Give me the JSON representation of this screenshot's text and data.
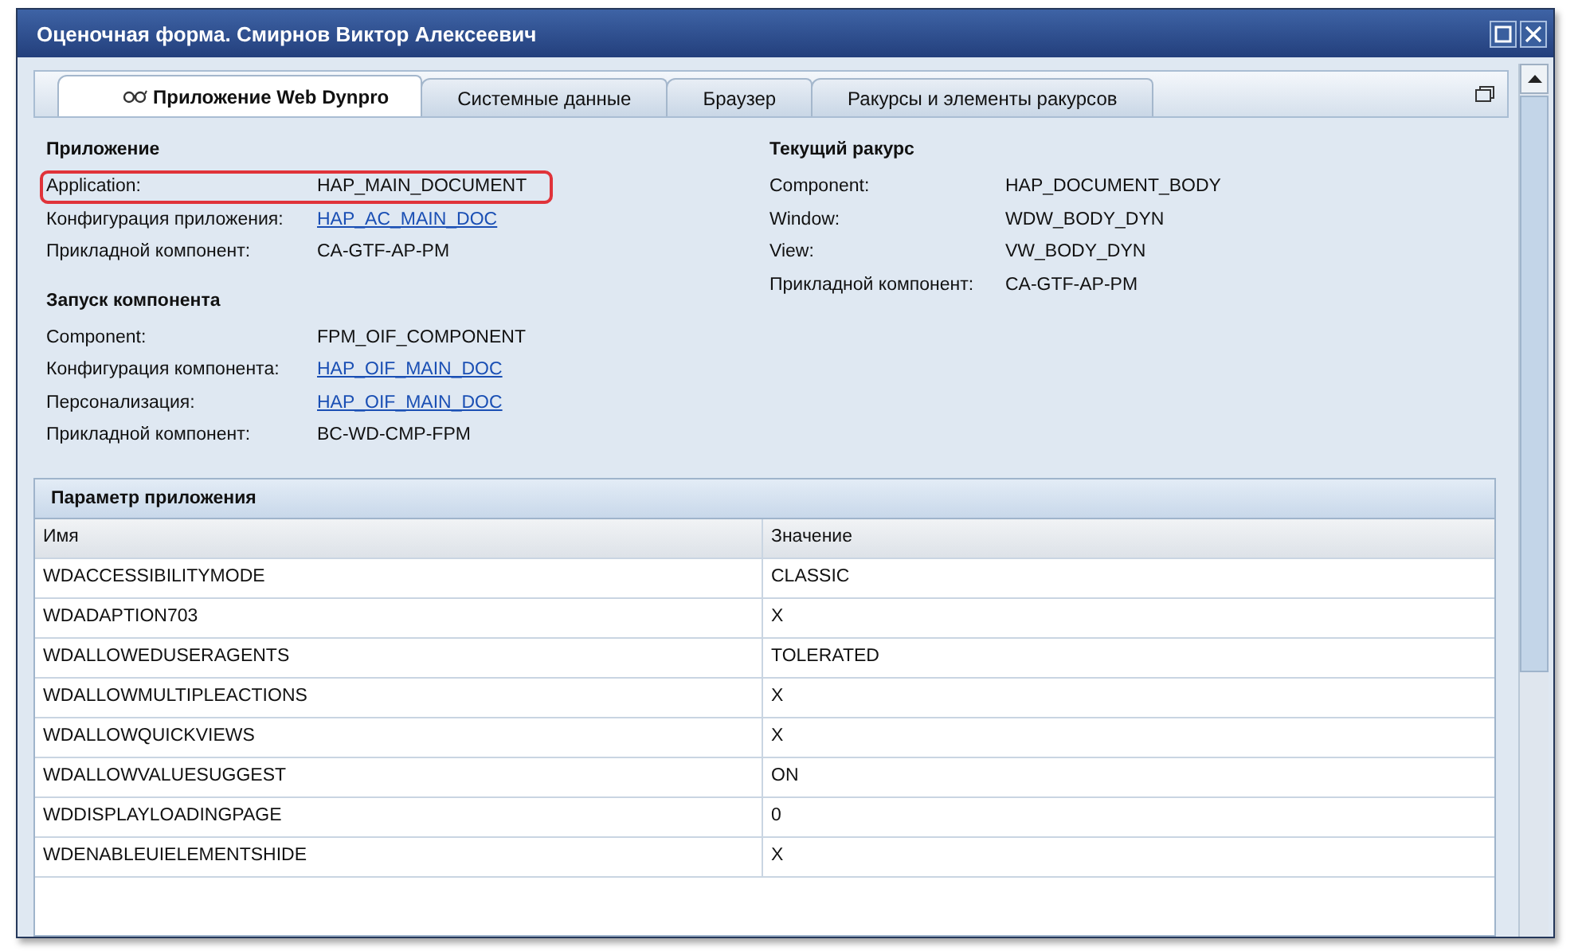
{
  "window": {
    "title": "Оценочная форма. Смирнов Виктор Алексеевич"
  },
  "tabs": [
    {
      "label": "Приложение Web Dynpro",
      "selected": true
    },
    {
      "label": "Системные данные",
      "selected": false
    },
    {
      "label": "Браузер",
      "selected": false
    },
    {
      "label": "Ракурсы и элементы ракурсов",
      "selected": false
    }
  ],
  "sections": [
    {
      "title": "Приложение",
      "fields": [
        {
          "label": "Application:",
          "value": "HAP_MAIN_DOCUMENT",
          "kind": "text",
          "highlighted": true
        },
        {
          "label": "Конфигурация приложения:",
          "value": "HAP_AC_MAIN_DOC",
          "kind": "link",
          "highlighted": false
        },
        {
          "label": "Прикладной компонент:",
          "value": "CA-GTF-AP-PM",
          "kind": "text",
          "highlighted": false
        }
      ]
    },
    {
      "title": "Текущий ракурс",
      "fields": [
        {
          "label": "Component:",
          "value": "HAP_DOCUMENT_BODY",
          "kind": "text",
          "highlighted": false
        },
        {
          "label": "Window:",
          "value": "WDW_BODY_DYN",
          "kind": "text",
          "highlighted": false
        },
        {
          "label": "View:",
          "value": "VW_BODY_DYN",
          "kind": "text",
          "highlighted": false
        },
        {
          "label": "Прикладной компонент:",
          "value": "CA-GTF-AP-PM",
          "kind": "text",
          "highlighted": false
        }
      ]
    },
    {
      "title": "Запуск компонента",
      "fields": [
        {
          "label": "Component:",
          "value": "FPM_OIF_COMPONENT",
          "kind": "text",
          "highlighted": false
        },
        {
          "label": "Конфигурация компонента:",
          "value": "HAP_OIF_MAIN_DOC",
          "kind": "link",
          "highlighted": false
        },
        {
          "label": "Персонализация:",
          "value": "HAP_OIF_MAIN_DOC",
          "kind": "link",
          "highlighted": false
        },
        {
          "label": "Прикладной компонент:",
          "value": "BC-WD-CMP-FPM",
          "kind": "text",
          "highlighted": false
        }
      ]
    }
  ],
  "table": {
    "title": "Параметр приложения",
    "columns": [
      "Имя",
      "Значение"
    ],
    "rows": [
      [
        "WDACCESSIBILITYMODE",
        "CLASSIC"
      ],
      [
        "WDADAPTION703",
        "X"
      ],
      [
        "WDALLOWEDUSERAGENTS",
        "TOLERATED"
      ],
      [
        "WDALLOWMULTIPLEACTIONS",
        "X"
      ],
      [
        "WDALLOWQUICKVIEWS",
        "X"
      ],
      [
        "WDALLOWVALUESUGGEST",
        "ON"
      ],
      [
        "WDDISPLAYLOADINGPAGE",
        "0"
      ],
      [
        "WDENABLEUIELEMENTSHIDE",
        "X"
      ]
    ]
  }
}
